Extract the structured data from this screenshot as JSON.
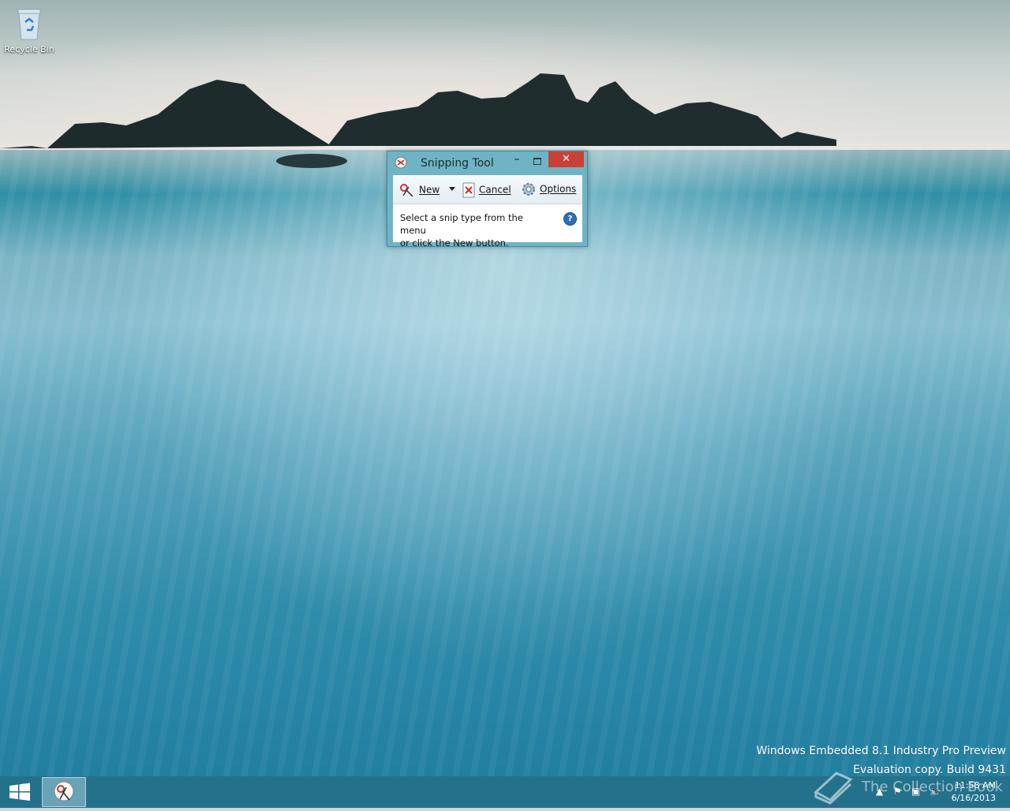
{
  "desktop": {
    "icons": [
      {
        "label": "Recycle Bin",
        "icon": "recycle-bin-icon"
      }
    ],
    "watermark": {
      "line1": "Windows Embedded 8.1 Industry Pro Preview",
      "line2": "Evaluation copy. Build 9431"
    },
    "overlay_text": "The Collection Book"
  },
  "snipping_tool": {
    "title": "Snipping Tool",
    "toolbar": {
      "new_label": "New",
      "cancel_label": "Cancel",
      "options_label": "Options"
    },
    "message_line1": "Select a snip type from the menu",
    "message_line2": "or click the New button.",
    "help": "?"
  },
  "taskbar": {
    "clock_time": "11:58 AM",
    "clock_date": "6/16/2013",
    "accent": "#246e87"
  }
}
